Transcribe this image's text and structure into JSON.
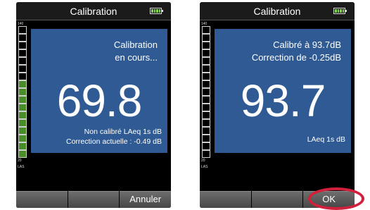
{
  "left_screen": {
    "title": "Calibration",
    "meter_top_label": "140",
    "meter_bottom_label": "20",
    "meter_mode_label": "LAS",
    "status_lines": [
      "Calibration",
      "en cours..."
    ],
    "big_value": "69.8",
    "info_lines": [
      "Non calibré LAeq 1s dB",
      "Correction actuelle : -0.49 dB"
    ],
    "softkeys": [
      "",
      "",
      "Annuler"
    ]
  },
  "right_screen": {
    "title": "Calibration",
    "meter_top_label": "140",
    "meter_bottom_label": "20",
    "meter_mode_label": "LAS",
    "status_lines": [
      "Calibré à 93.7dB",
      "Correction de -0.25dB"
    ],
    "big_value": "93.7",
    "info_lines": [
      "LAeq 1s dB"
    ],
    "softkeys": [
      "",
      "",
      "OK"
    ]
  },
  "colors": {
    "panel_blue": "#2f5a93",
    "meter_green": "#4a8c2a",
    "battery_green": "#7fd34a",
    "highlight_red": "#d21f3c"
  }
}
